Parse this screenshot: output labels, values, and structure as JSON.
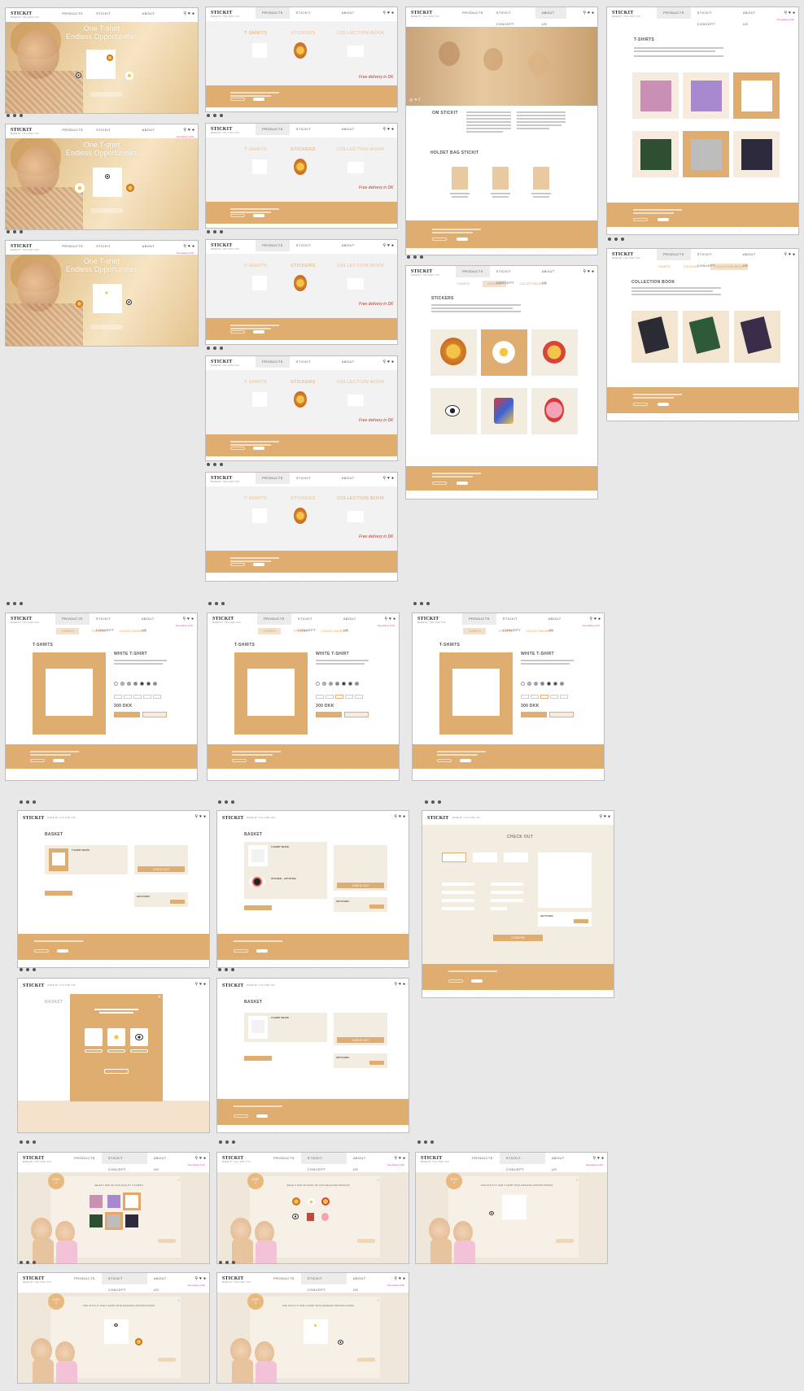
{
  "brand": {
    "logo": "STICKIT",
    "tagline": "MADE BY YOU FOR YOU"
  },
  "nav": {
    "products": "PRODUCTS",
    "concept": "STICKIT CONCEPT",
    "about": "ABOUT US"
  },
  "hero": {
    "line1": "One T-shirt",
    "line2": "Endless Opportunities"
  },
  "categories": {
    "tshirts": "T-SHIRTS",
    "stickers": "STICKERS",
    "book": "COLLECTION BOOK"
  },
  "free_delivery": "Free delivery in DK",
  "about": {
    "heading": "OM STICKIT",
    "team_heading": "HOLDET BAG STICKIT"
  },
  "pages": {
    "tshirts": "T-SHIRTS",
    "stickers": "STICKERS",
    "collection": "COLLECTION BOOK",
    "product_title": "WHITE T-SHIRT",
    "price": "300 DKK",
    "basket": "BASKET",
    "checkout": "CHECK OUT",
    "checkout_btn": "CHECK OUT",
    "confirm_btn": "CONFIRM",
    "giftcard": "GIFTCARD:",
    "basket_item": "T-SHIRT WHITE",
    "basket_item2": "STICKER - APTITUDE"
  },
  "concept_steps": {
    "s1": "SELECT ONE OF OUR QUALITY T-SHIRTS",
    "s2": "SELECT ONE OR MANY OF OUR SELECTED DESIGNS",
    "s3": "AND STICK IT! ONE T-SHIRT WITH ENDLESS OPPORTUNITIES"
  },
  "colors": {
    "accent": "#dfad70",
    "promo": "#d23aa3",
    "category": "#e6a766",
    "background": "#e8e8e8"
  },
  "tshirt_colors": [
    "#ffffff",
    "#d8a5c8",
    "#b49ad8",
    "#6f8aa3",
    "#2e2e36",
    "#355a3a",
    "#8c9a78"
  ]
}
